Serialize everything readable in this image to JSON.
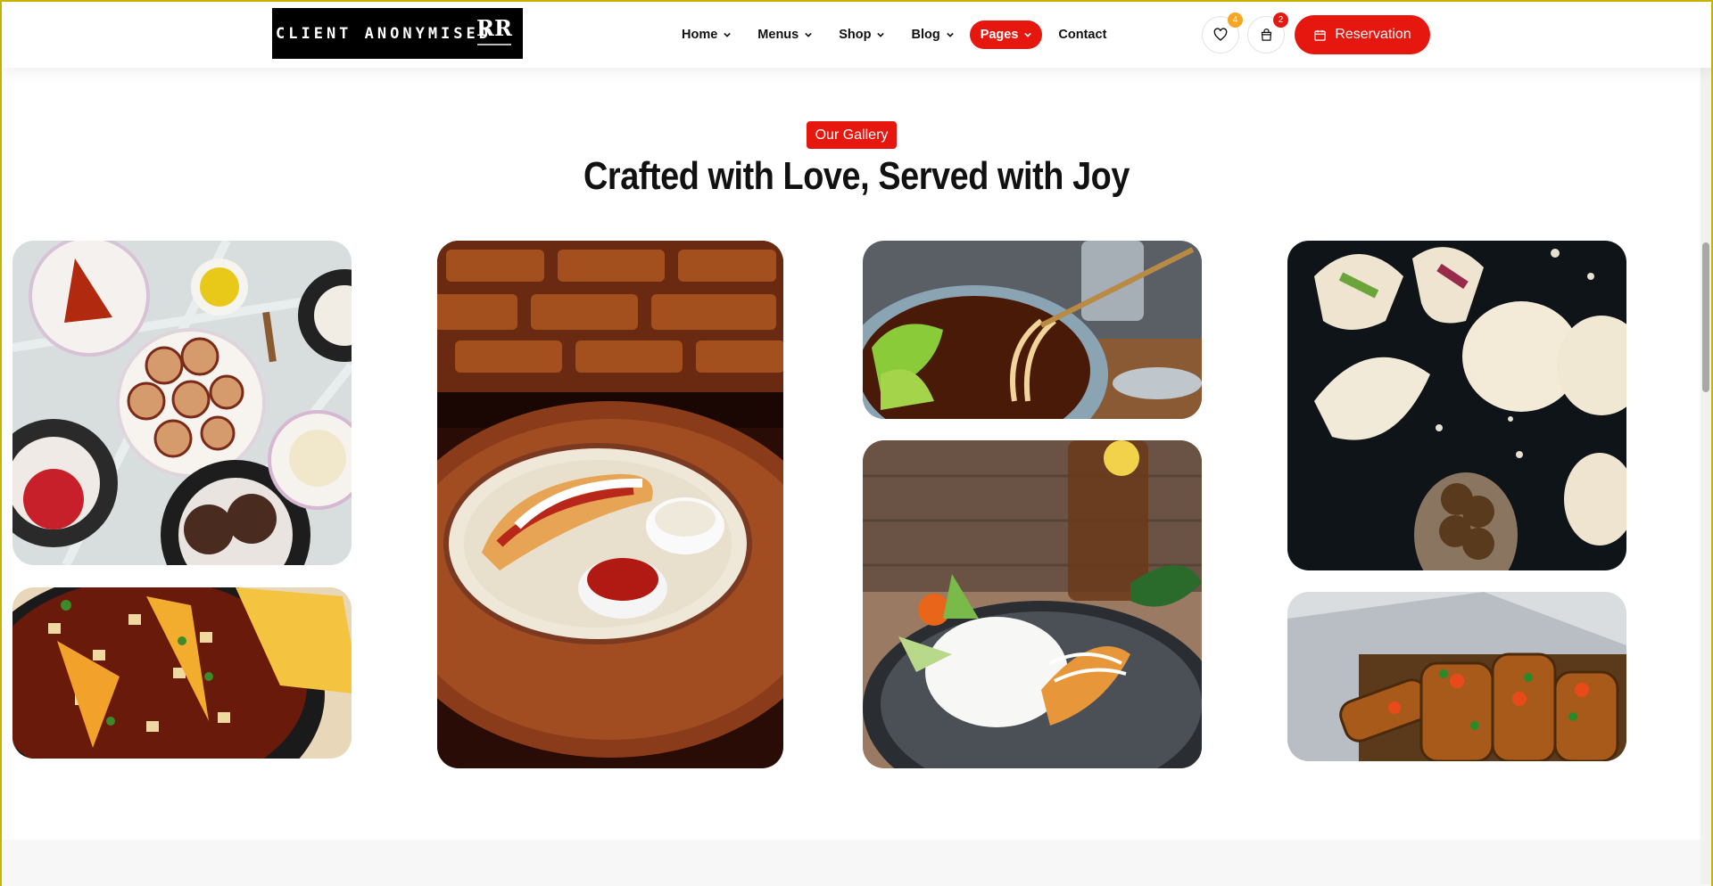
{
  "header": {
    "logo_text": "CLIENT ANONYMISED",
    "logo_monogram": "RR",
    "nav": [
      {
        "label": "Home",
        "has_dropdown": true
      },
      {
        "label": "Menus",
        "has_dropdown": true
      },
      {
        "label": "Shop",
        "has_dropdown": true
      },
      {
        "label": "Blog",
        "has_dropdown": true
      },
      {
        "label": "Pages",
        "has_dropdown": true,
        "active": true
      },
      {
        "label": "Contact",
        "has_dropdown": false
      }
    ],
    "wishlist_count": "4",
    "cart_count": "2",
    "reservation_label": "Reservation"
  },
  "gallery": {
    "tag": "Our Gallery",
    "title": "Crafted with Love, Served with Joy",
    "images": [
      {
        "subject": "dessert-spread"
      },
      {
        "subject": "nachos-bowl"
      },
      {
        "subject": "hotdog-plate"
      },
      {
        "subject": "noodle-soup"
      },
      {
        "subject": "rice-shrimp-plate"
      },
      {
        "subject": "pita-falafel"
      },
      {
        "subject": "stuffed-vegetables"
      }
    ]
  },
  "colors": {
    "accent": "#e6170f",
    "badge_wishlist": "#f5a623",
    "badge_cart": "#e6170f",
    "title": "#111111"
  }
}
